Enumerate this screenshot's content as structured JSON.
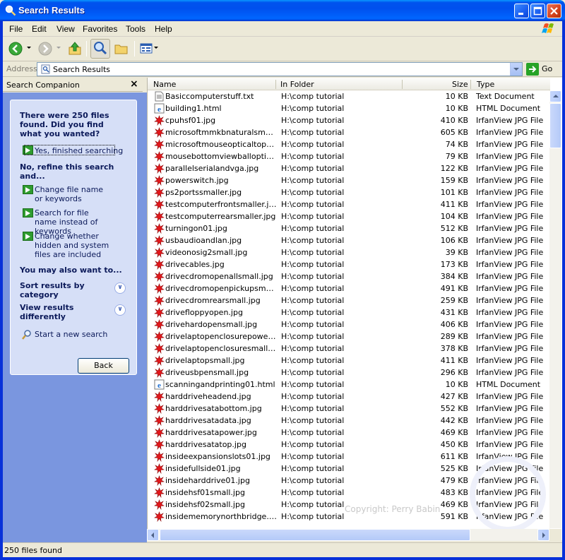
{
  "window": {
    "title": "Search Results"
  },
  "menu": [
    "File",
    "Edit",
    "View",
    "Favorites",
    "Tools",
    "Help"
  ],
  "address": {
    "label": "Address",
    "value": "Search Results",
    "go_label": "Go"
  },
  "search_companion": {
    "title": "Search Companion",
    "close_label": "×",
    "result_text": "There were 250 files found. Did you find what you wanted?",
    "yes_option": "Yes, finished searching",
    "refine_heading": "No, refine this search and...",
    "refine_options": [
      "Change file name or keywords",
      "Search for file name instead of keywords",
      "Change whether hidden and system files are included"
    ],
    "also_heading": "You may also want to...",
    "sort_label": "Sort results by category",
    "view_label": "View results differently",
    "new_search_label": "Start a new search",
    "back_label": "Back"
  },
  "columns": {
    "name": "Name",
    "folder": "In Folder",
    "size": "Size",
    "type": "Type"
  },
  "files": [
    {
      "name": "Basiccomputerstuff.txt",
      "folder": "H:\\comp tutorial",
      "size": "10 KB",
      "type": "Text Document",
      "icon": "text-file-icon"
    },
    {
      "name": "building1.html",
      "folder": "H:\\comp tutorial",
      "size": "10 KB",
      "type": "HTML Document",
      "icon": "ie-html-icon"
    },
    {
      "name": "cpuhsf01.jpg",
      "folder": "H:\\comp tutorial",
      "size": "410 KB",
      "type": "IrfanView JPG File",
      "icon": "irfanview-icon"
    },
    {
      "name": "microsoftmmkbnaturalsmaller....",
      "folder": "H:\\comp tutorial",
      "size": "605 KB",
      "type": "IrfanView JPG File",
      "icon": "irfanview-icon"
    },
    {
      "name": "microsoftmouseopticaltopsmal...",
      "folder": "H:\\comp tutorial",
      "size": "74 KB",
      "type": "IrfanView JPG File",
      "icon": "irfanview-icon"
    },
    {
      "name": "mousebottomviewballopticals....",
      "folder": "H:\\comp tutorial",
      "size": "79 KB",
      "type": "IrfanView JPG File",
      "icon": "irfanview-icon"
    },
    {
      "name": "parallelserialandvga.jpg",
      "folder": "H:\\comp tutorial",
      "size": "122 KB",
      "type": "IrfanView JPG File",
      "icon": "irfanview-icon"
    },
    {
      "name": "powerswitch.jpg",
      "folder": "H:\\comp tutorial",
      "size": "159 KB",
      "type": "IrfanView JPG File",
      "icon": "irfanview-icon"
    },
    {
      "name": "ps2portssmaller.jpg",
      "folder": "H:\\comp tutorial",
      "size": "101 KB",
      "type": "IrfanView JPG File",
      "icon": "irfanview-icon"
    },
    {
      "name": "testcomputerfrontsmaller.jpg",
      "folder": "H:\\comp tutorial",
      "size": "411 KB",
      "type": "IrfanView JPG File",
      "icon": "irfanview-icon"
    },
    {
      "name": "testcomputerrearsmaller.jpg",
      "folder": "H:\\comp tutorial",
      "size": "104 KB",
      "type": "IrfanView JPG File",
      "icon": "irfanview-icon"
    },
    {
      "name": "turningon01.jpg",
      "folder": "H:\\comp tutorial",
      "size": "512 KB",
      "type": "IrfanView JPG File",
      "icon": "irfanview-icon"
    },
    {
      "name": "usbaudioandlan.jpg",
      "folder": "H:\\comp tutorial",
      "size": "106 KB",
      "type": "IrfanView JPG File",
      "icon": "irfanview-icon"
    },
    {
      "name": "videonosig2small.jpg",
      "folder": "H:\\comp tutorial",
      "size": "39 KB",
      "type": "IrfanView JPG File",
      "icon": "irfanview-icon"
    },
    {
      "name": "drivecables.jpg",
      "folder": "H:\\comp tutorial",
      "size": "173 KB",
      "type": "IrfanView JPG File",
      "icon": "irfanview-icon"
    },
    {
      "name": "drivecdromopenallsmall.jpg",
      "folder": "H:\\comp tutorial",
      "size": "384 KB",
      "type": "IrfanView JPG File",
      "icon": "irfanview-icon"
    },
    {
      "name": "drivecdromopenpickupsmall.jpg",
      "folder": "H:\\comp tutorial",
      "size": "491 KB",
      "type": "IrfanView JPG File",
      "icon": "irfanview-icon"
    },
    {
      "name": "drivecdromrearsmall.jpg",
      "folder": "H:\\comp tutorial",
      "size": "259 KB",
      "type": "IrfanView JPG File",
      "icon": "irfanview-icon"
    },
    {
      "name": "drivefloppyopen.jpg",
      "folder": "H:\\comp tutorial",
      "size": "431 KB",
      "type": "IrfanView JPG File",
      "icon": "irfanview-icon"
    },
    {
      "name": "drivehardopensmall.jpg",
      "folder": "H:\\comp tutorial",
      "size": "406 KB",
      "type": "IrfanView JPG File",
      "icon": "irfanview-icon"
    },
    {
      "name": "drivelaptopenclosurepowerplu...",
      "folder": "H:\\comp tutorial",
      "size": "289 KB",
      "type": "IrfanView JPG File",
      "icon": "irfanview-icon"
    },
    {
      "name": "drivelaptopenclosuresmall.jpg",
      "folder": "H:\\comp tutorial",
      "size": "378 KB",
      "type": "IrfanView JPG File",
      "icon": "irfanview-icon"
    },
    {
      "name": "drivelaptopsmall.jpg",
      "folder": "H:\\comp tutorial",
      "size": "411 KB",
      "type": "IrfanView JPG File",
      "icon": "irfanview-icon"
    },
    {
      "name": "driveusbpensmall.jpg",
      "folder": "H:\\comp tutorial",
      "size": "296 KB",
      "type": "IrfanView JPG File",
      "icon": "irfanview-icon"
    },
    {
      "name": "scanningandprinting01.html",
      "folder": "H:\\comp tutorial",
      "size": "10 KB",
      "type": "HTML Document",
      "icon": "ie-html-icon"
    },
    {
      "name": "harddriveheadend.jpg",
      "folder": "H:\\comp tutorial",
      "size": "427 KB",
      "type": "IrfanView JPG File",
      "icon": "irfanview-icon"
    },
    {
      "name": "harddrivesatabottom.jpg",
      "folder": "H:\\comp tutorial",
      "size": "552 KB",
      "type": "IrfanView JPG File",
      "icon": "irfanview-icon"
    },
    {
      "name": "harddrivesatadata.jpg",
      "folder": "H:\\comp tutorial",
      "size": "442 KB",
      "type": "IrfanView JPG File",
      "icon": "irfanview-icon"
    },
    {
      "name": "harddrivesatapower.jpg",
      "folder": "H:\\comp tutorial",
      "size": "469 KB",
      "type": "IrfanView JPG File",
      "icon": "irfanview-icon"
    },
    {
      "name": "harddrivesatatop.jpg",
      "folder": "H:\\comp tutorial",
      "size": "450 KB",
      "type": "IrfanView JPG File",
      "icon": "irfanview-icon"
    },
    {
      "name": "insideexpansionslots01.jpg",
      "folder": "H:\\comp tutorial",
      "size": "611 KB",
      "type": "IrfanView JPG File",
      "icon": "irfanview-icon"
    },
    {
      "name": "insidefullside01.jpg",
      "folder": "H:\\comp tutorial",
      "size": "525 KB",
      "type": "IrfanView JPG File",
      "icon": "irfanview-icon"
    },
    {
      "name": "insideharddrive01.jpg",
      "folder": "H:\\comp tutorial",
      "size": "479 KB",
      "type": "IrfanView JPG File",
      "icon": "irfanview-icon"
    },
    {
      "name": "insidehsf01small.jpg",
      "folder": "H:\\comp tutorial",
      "size": "483 KB",
      "type": "IrfanView JPG File",
      "icon": "irfanview-icon"
    },
    {
      "name": "insidehsf02small.jpg",
      "folder": "H:\\comp tutorial",
      "size": "469 KB",
      "type": "IrfanView JPG File",
      "icon": "irfanview-icon"
    },
    {
      "name": "insidememorynorthbridge.jpg",
      "folder": "H:\\comp tutorial",
      "size": "591 KB",
      "type": "IrfanView JPG File",
      "icon": "irfanview-icon"
    }
  ],
  "watermark": "Copyright: Perry Babin",
  "status": {
    "text": "250 files found"
  },
  "colors": {
    "title_blue": "#0053ee",
    "pane_blue": "#7a96df",
    "box_blue": "#d6dff7",
    "xp_beige": "#ece9d8"
  }
}
